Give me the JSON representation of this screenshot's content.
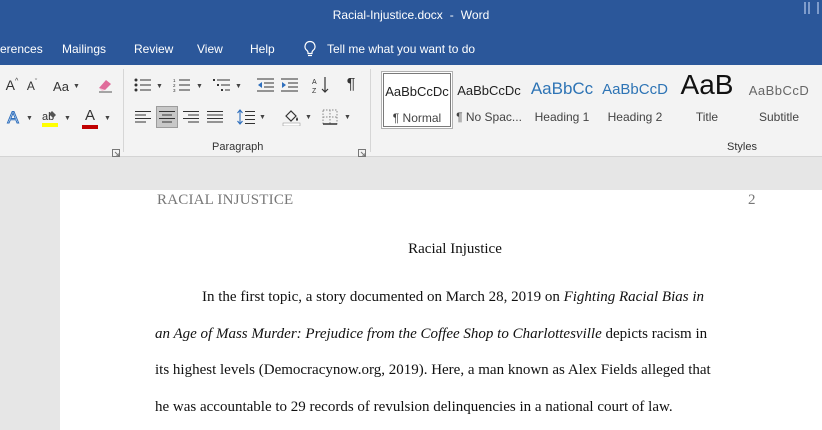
{
  "window": {
    "filename": "Racial-Injustice.docx",
    "separator": "-",
    "app_name": "Word"
  },
  "tabs": [
    {
      "label": "erences"
    },
    {
      "label": "Mailings"
    },
    {
      "label": "Review"
    },
    {
      "label": "View"
    },
    {
      "label": "Help"
    }
  ],
  "tell_me": {
    "label": "Tell me what you want to do",
    "icon": "lightbulb-icon"
  },
  "ribbon": {
    "font_group": {
      "grow_font": "A",
      "shrink_font": "A",
      "change_case": "Aa",
      "text_effects": "A",
      "font_color": "A",
      "font_color_hex": "#c00000",
      "highlight_color_hex": "#ffff00"
    },
    "paragraph_group": {
      "label": "Paragraph"
    },
    "styles_group": {
      "label": "Styles",
      "styles": [
        {
          "preview": "AaBbCcDc",
          "name": "¶ Normal",
          "selected": true
        },
        {
          "preview": "AaBbCcDc",
          "name": "¶ No Spac..."
        },
        {
          "preview": "AaBbCc",
          "name": "Heading 1"
        },
        {
          "preview": "AaBbCcD",
          "name": "Heading 2"
        },
        {
          "preview": "AaB",
          "name": "Title"
        },
        {
          "preview": "AaBbCcD",
          "name": "Subtitle"
        }
      ]
    }
  },
  "document": {
    "running_head": "RACIAL INJUSTICE",
    "page_number": "2",
    "title": "Racial Injustice",
    "lines": [
      {
        "a": "In the first topic, a story documented on March 28, 2019 on ",
        "i": "Fighting Racial Bias in"
      },
      {
        "i": "an Age of Mass Murder: Prejudice from the Coffee Shop to Charlottesville",
        "b": " depicts racism in"
      },
      {
        "a": "its highest levels (Democracynow.org, 2019). Here, a man known as Alex Fields alleged that"
      },
      {
        "a": "he was accountable to 29 records of revulsion delinquencies in a national court of law."
      }
    ]
  }
}
